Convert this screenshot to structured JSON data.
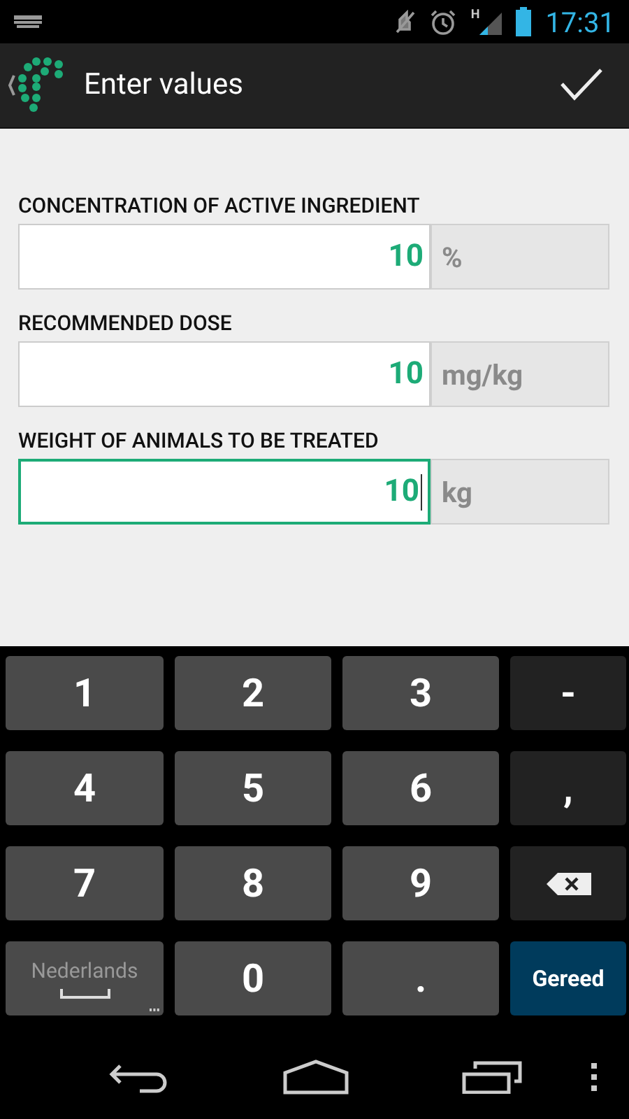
{
  "status_bar": {
    "network": "H",
    "time": "17:31"
  },
  "action_bar": {
    "title": "Enter values"
  },
  "fields": [
    {
      "label": "CONCENTRATION OF ACTIVE INGREDIENT",
      "value": "10",
      "unit": "%",
      "focused": false
    },
    {
      "label": "RECOMMENDED DOSE",
      "value": "10",
      "unit": "mg/kg",
      "focused": false
    },
    {
      "label": "WEIGHT OF ANIMALS TO BE TREATED",
      "value": "10",
      "unit": "kg",
      "focused": true
    }
  ],
  "keyboard": {
    "keys": [
      {
        "kind": "digit",
        "label": "1"
      },
      {
        "kind": "digit",
        "label": "2"
      },
      {
        "kind": "digit",
        "label": "3"
      },
      {
        "kind": "symbol",
        "label": "-"
      },
      {
        "kind": "digit",
        "label": "4"
      },
      {
        "kind": "digit",
        "label": "5"
      },
      {
        "kind": "digit",
        "label": "6"
      },
      {
        "kind": "symbol",
        "label": ","
      },
      {
        "kind": "digit",
        "label": "7"
      },
      {
        "kind": "digit",
        "label": "8"
      },
      {
        "kind": "digit",
        "label": "9"
      },
      {
        "kind": "backspace"
      },
      {
        "kind": "language",
        "label": "Nederlands"
      },
      {
        "kind": "digit",
        "label": "0"
      },
      {
        "kind": "digit",
        "label": "."
      },
      {
        "kind": "done",
        "label": "Gereed"
      }
    ]
  }
}
